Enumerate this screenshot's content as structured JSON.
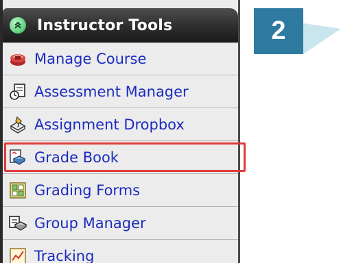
{
  "panel": {
    "title": "Instructor Tools",
    "toggle_icon": "chevron-up-circle-icon",
    "items": [
      {
        "label": "Manage Course",
        "icon": "manage-course-icon"
      },
      {
        "label": "Assessment Manager",
        "icon": "assessment-manager-icon"
      },
      {
        "label": "Assignment Dropbox",
        "icon": "assignment-dropbox-icon"
      },
      {
        "label": "Grade Book",
        "icon": "grade-book-icon",
        "highlighted": true
      },
      {
        "label": "Grading Forms",
        "icon": "grading-forms-icon"
      },
      {
        "label": "Group Manager",
        "icon": "group-manager-icon"
      },
      {
        "label": "Tracking",
        "icon": "tracking-icon"
      }
    ]
  },
  "step_badge": {
    "number": "2"
  },
  "colors": {
    "link": "#1a2bbf",
    "highlight_border": "#e03a3a",
    "badge": "#2f7aa1",
    "callout": "#c9e6ef",
    "header": "#2d2d2d"
  }
}
